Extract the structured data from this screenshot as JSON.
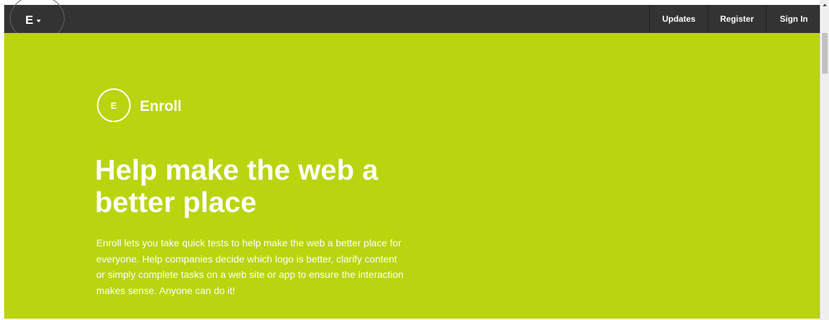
{
  "header": {
    "brand_letter": "E",
    "nav": [
      {
        "label": "Updates"
      },
      {
        "label": "Register"
      },
      {
        "label": "Sign In"
      }
    ]
  },
  "hero": {
    "logo_letter": "E",
    "logo_text": "Enroll",
    "headline": "Help make the web a better place",
    "description": "Enroll lets you take quick tests to help make the web a better place for everyone. Help companies decide which logo is better, clarify content or simply complete tasks on a web site or app to ensure the interaction makes sense. Anyone can do it!"
  },
  "icons": {
    "brand_menu_caret": "caret-down-icon",
    "scroll_up": "arrow-up-icon"
  },
  "colors": {
    "topbar": "#333333",
    "hero_background": "#bad40e",
    "text": "#ffffff"
  }
}
